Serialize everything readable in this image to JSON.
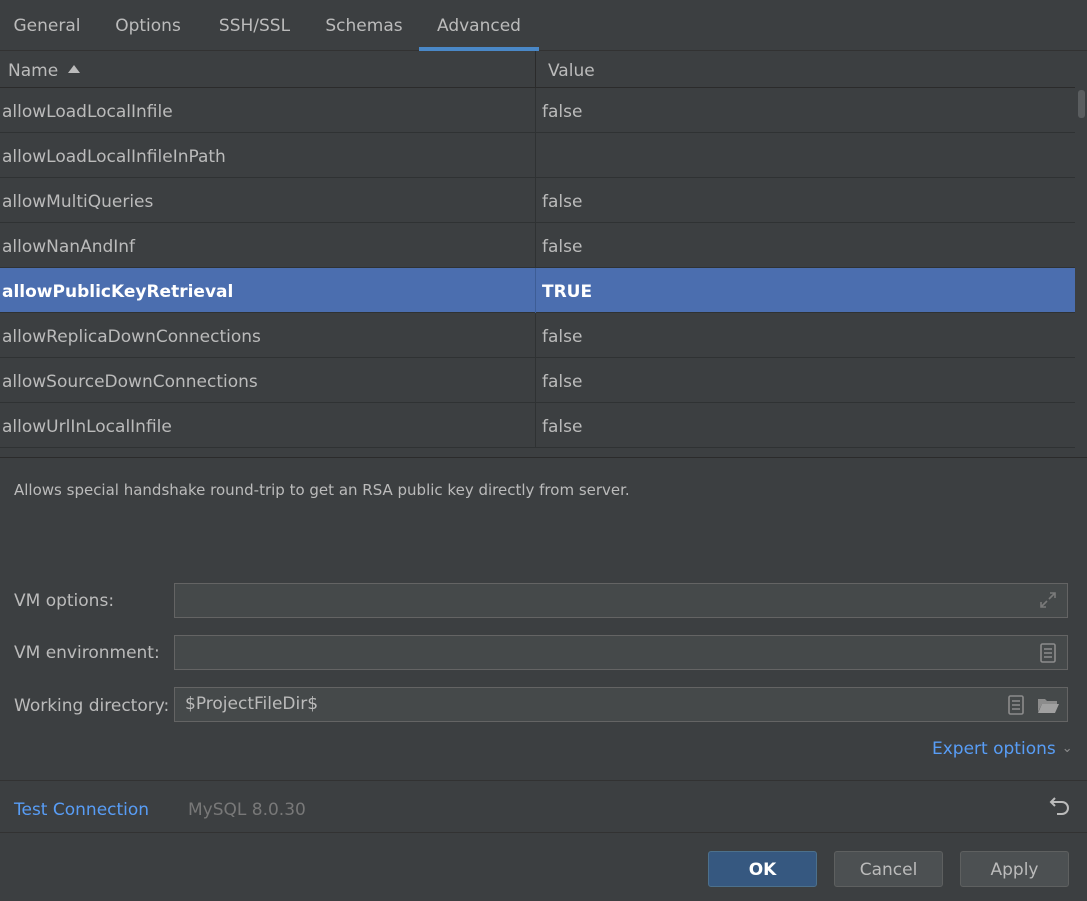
{
  "tabs": [
    {
      "label": "General"
    },
    {
      "label": "Options"
    },
    {
      "label": "SSH/SSL"
    },
    {
      "label": "Schemas"
    },
    {
      "label": "Advanced"
    }
  ],
  "active_tab": "Advanced",
  "table": {
    "columns": {
      "name": "Name",
      "value": "Value"
    },
    "sort": {
      "column": "Name",
      "direction": "ascending",
      "icon": "sort-ascending-icon"
    },
    "rows": [
      {
        "name": "allowLoadLocalInfile",
        "value": "false"
      },
      {
        "name": "allowLoadLocalInfileInPath",
        "value": ""
      },
      {
        "name": "allowMultiQueries",
        "value": "false"
      },
      {
        "name": "allowNanAndInf",
        "value": "false"
      },
      {
        "name": "allowPublicKeyRetrieval",
        "value": "TRUE"
      },
      {
        "name": "allowReplicaDownConnections",
        "value": "false"
      },
      {
        "name": "allowSourceDownConnections",
        "value": "false"
      },
      {
        "name": "allowUrlInLocalInfile",
        "value": "false"
      }
    ],
    "selected_row": "allowPublicKeyRetrieval"
  },
  "description": "Allows special handshake round-trip to get an RSA public key directly from server.",
  "fields": {
    "vm_options": {
      "label": "VM options:",
      "value": "",
      "icon": "expand-icon"
    },
    "vm_environment": {
      "label": "VM environment:",
      "value": "",
      "icon": "document-icon"
    },
    "working_directory": {
      "label": "Working directory:",
      "value": "$ProjectFileDir$",
      "icons": [
        "document-icon",
        "folder-icon"
      ]
    }
  },
  "expert_options": {
    "label": "Expert options",
    "icon": "chevron-down-icon"
  },
  "footer": {
    "test_connection": "Test Connection",
    "driver_info": "MySQL 8.0.30",
    "revert_icon": "revert-icon"
  },
  "buttons": {
    "ok": "OK",
    "cancel": "Cancel",
    "apply": "Apply"
  },
  "colors": {
    "background": "#3c3f41",
    "selection": "#4b6eaf",
    "link": "#589df6",
    "tab_underline": "#4a88c7",
    "ok_button": "#365880"
  }
}
